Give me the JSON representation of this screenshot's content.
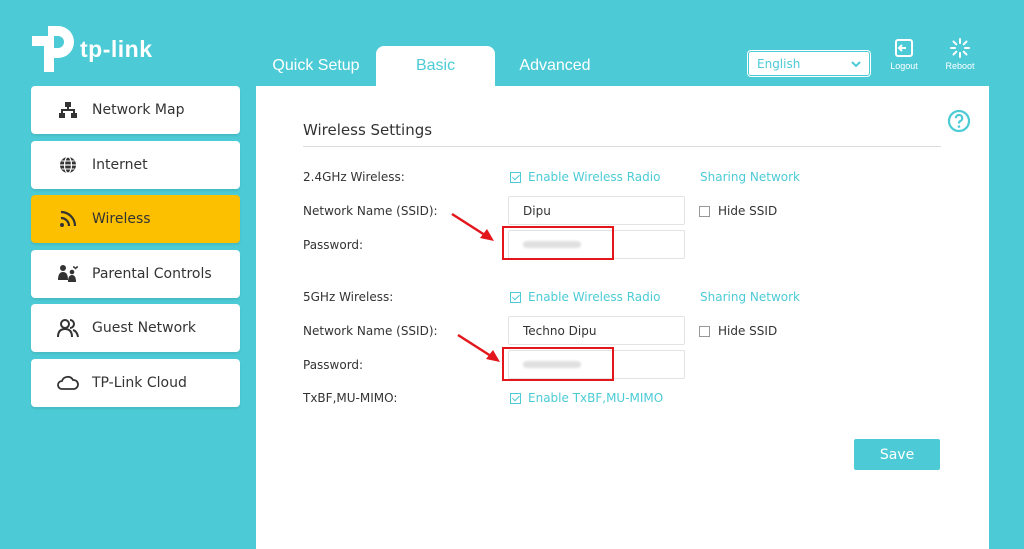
{
  "brand": {
    "name": "tp-link"
  },
  "tabs": [
    {
      "label": "Quick Setup"
    },
    {
      "label": "Basic"
    },
    {
      "label": "Advanced"
    }
  ],
  "language": {
    "selected": "English"
  },
  "topbar": {
    "logout_label": "Logout",
    "reboot_label": "Reboot"
  },
  "sidebar": {
    "items": [
      {
        "label": "Network Map",
        "icon": "network-map-icon"
      },
      {
        "label": "Internet",
        "icon": "globe-icon"
      },
      {
        "label": "Wireless",
        "icon": "wifi-icon",
        "active": true
      },
      {
        "label": "Parental Controls",
        "icon": "parental-icon"
      },
      {
        "label": "Guest Network",
        "icon": "guest-icon"
      },
      {
        "label": "TP-Link Cloud",
        "icon": "cloud-icon"
      }
    ]
  },
  "main": {
    "title": "Wireless Settings",
    "band24": {
      "label": "2.4GHz Wireless:",
      "enable_label": "Enable Wireless Radio",
      "enabled": true,
      "share_label": "Sharing Network",
      "ssid_label": "Network Name (SSID):",
      "ssid_value": "Dipu",
      "hide_label": "Hide SSID",
      "password_label": "Password:"
    },
    "band5": {
      "label": "5GHz Wireless:",
      "enable_label": "Enable Wireless Radio",
      "enabled": true,
      "share_label": "Sharing Network",
      "ssid_label": "Network Name (SSID):",
      "ssid_value": "Techno Dipu",
      "hide_label": "Hide SSID",
      "password_label": "Password:"
    },
    "mimo": {
      "label": "TxBF,MU-MIMO:",
      "enable_label": "Enable TxBF,MU-MIMO",
      "enabled": true
    },
    "save_label": "Save"
  },
  "colors": {
    "accent": "#4ccbd6",
    "active_sidebar": "#fcc000",
    "annotation": "#e3161b"
  }
}
